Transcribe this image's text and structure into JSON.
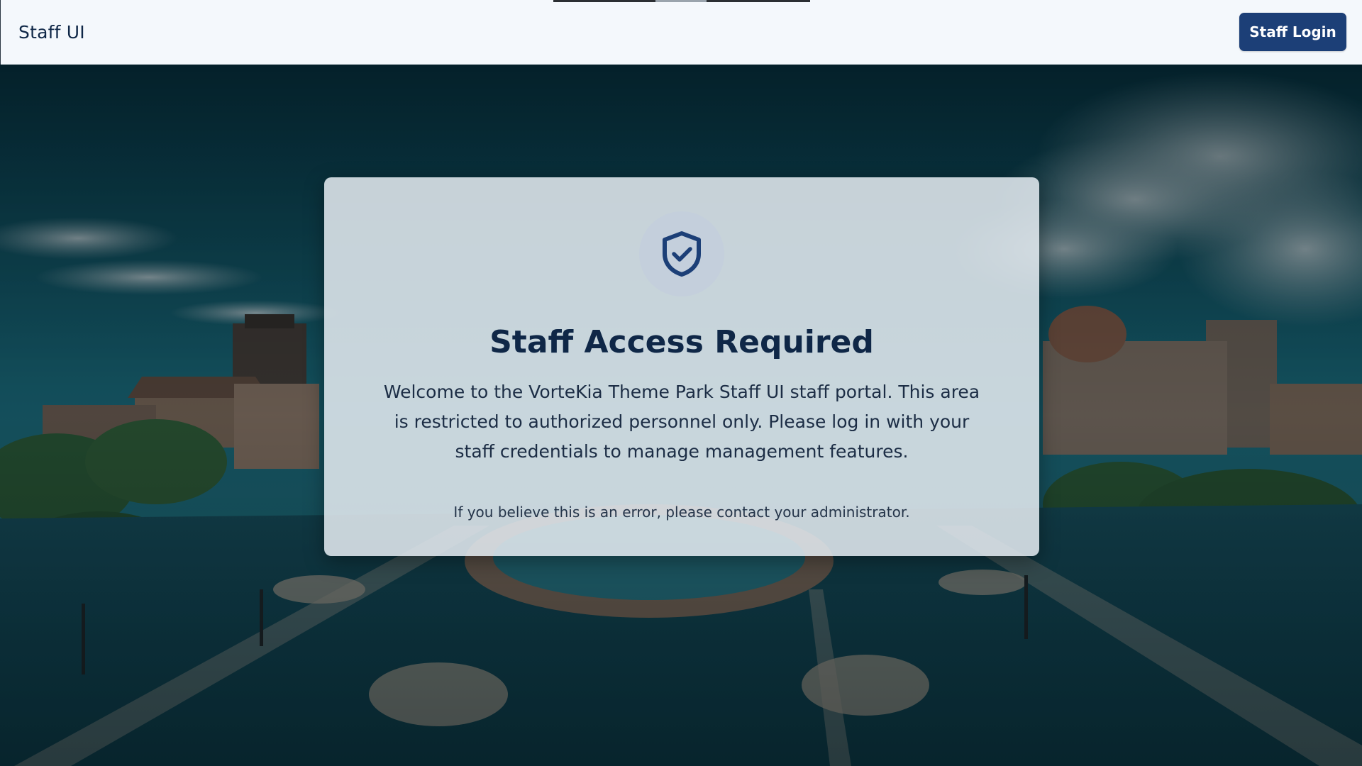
{
  "header": {
    "brand": "Staff UI",
    "login_label": "Staff Login"
  },
  "card": {
    "icon": "shield-check-icon",
    "title": "Staff Access Required",
    "body": "Welcome to the VorteKia Theme Park Staff UI staff portal. This area is restricted to authorized personnel only. Please log in with your staff credentials to manage management features.",
    "note": "If you believe this is an error, please contact your administrator."
  },
  "colors": {
    "header_bg": "#f4f8fc",
    "primary": "#1c3f77",
    "title_text": "#0f2747",
    "card_bg": "#e4eaf0",
    "icon_circle": "#c4cfdc"
  }
}
